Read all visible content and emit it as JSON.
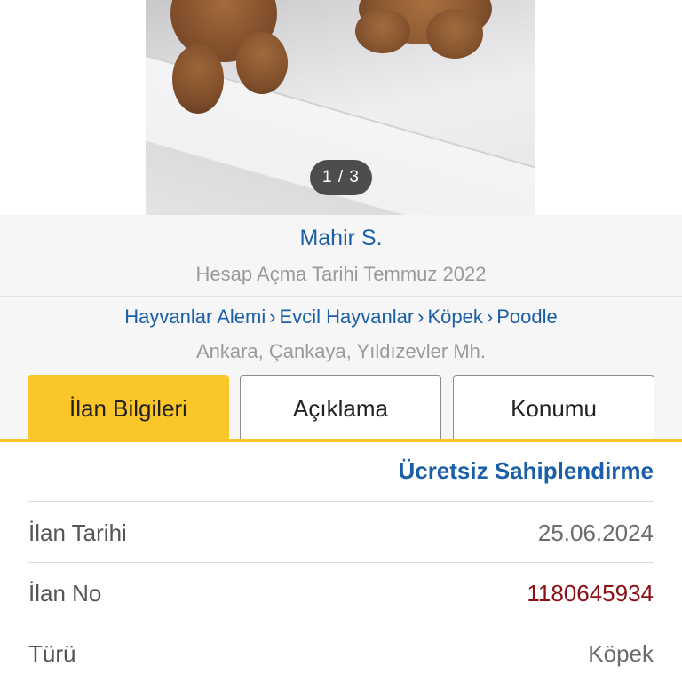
{
  "gallery": {
    "counter": "1 / 3"
  },
  "seller": {
    "name": "Mahir S.",
    "since": "Hesap Açma Tarihi Temmuz 2022"
  },
  "breadcrumb": {
    "items": [
      "Hayvanlar Alemi",
      "Evcil Hayvanlar",
      "Köpek",
      "Poodle"
    ],
    "separator": "›"
  },
  "location": "Ankara, Çankaya, Yıldızevler Mh.",
  "tabs": [
    {
      "label": "İlan Bilgileri",
      "active": true
    },
    {
      "label": "Açıklama",
      "active": false
    },
    {
      "label": "Konumu",
      "active": false
    }
  ],
  "listing": {
    "price": "Ücretsiz Sahiplendirme",
    "rows": [
      {
        "label": "İlan Tarihi",
        "value": "25.06.2024"
      },
      {
        "label": "İlan No",
        "value": "1180645934"
      },
      {
        "label": "Türü",
        "value": "Köpek"
      }
    ]
  },
  "colors": {
    "accent_yellow": "#fbc62a",
    "link_blue": "#1a5fa8",
    "listing_no_red": "#8b0f14"
  }
}
